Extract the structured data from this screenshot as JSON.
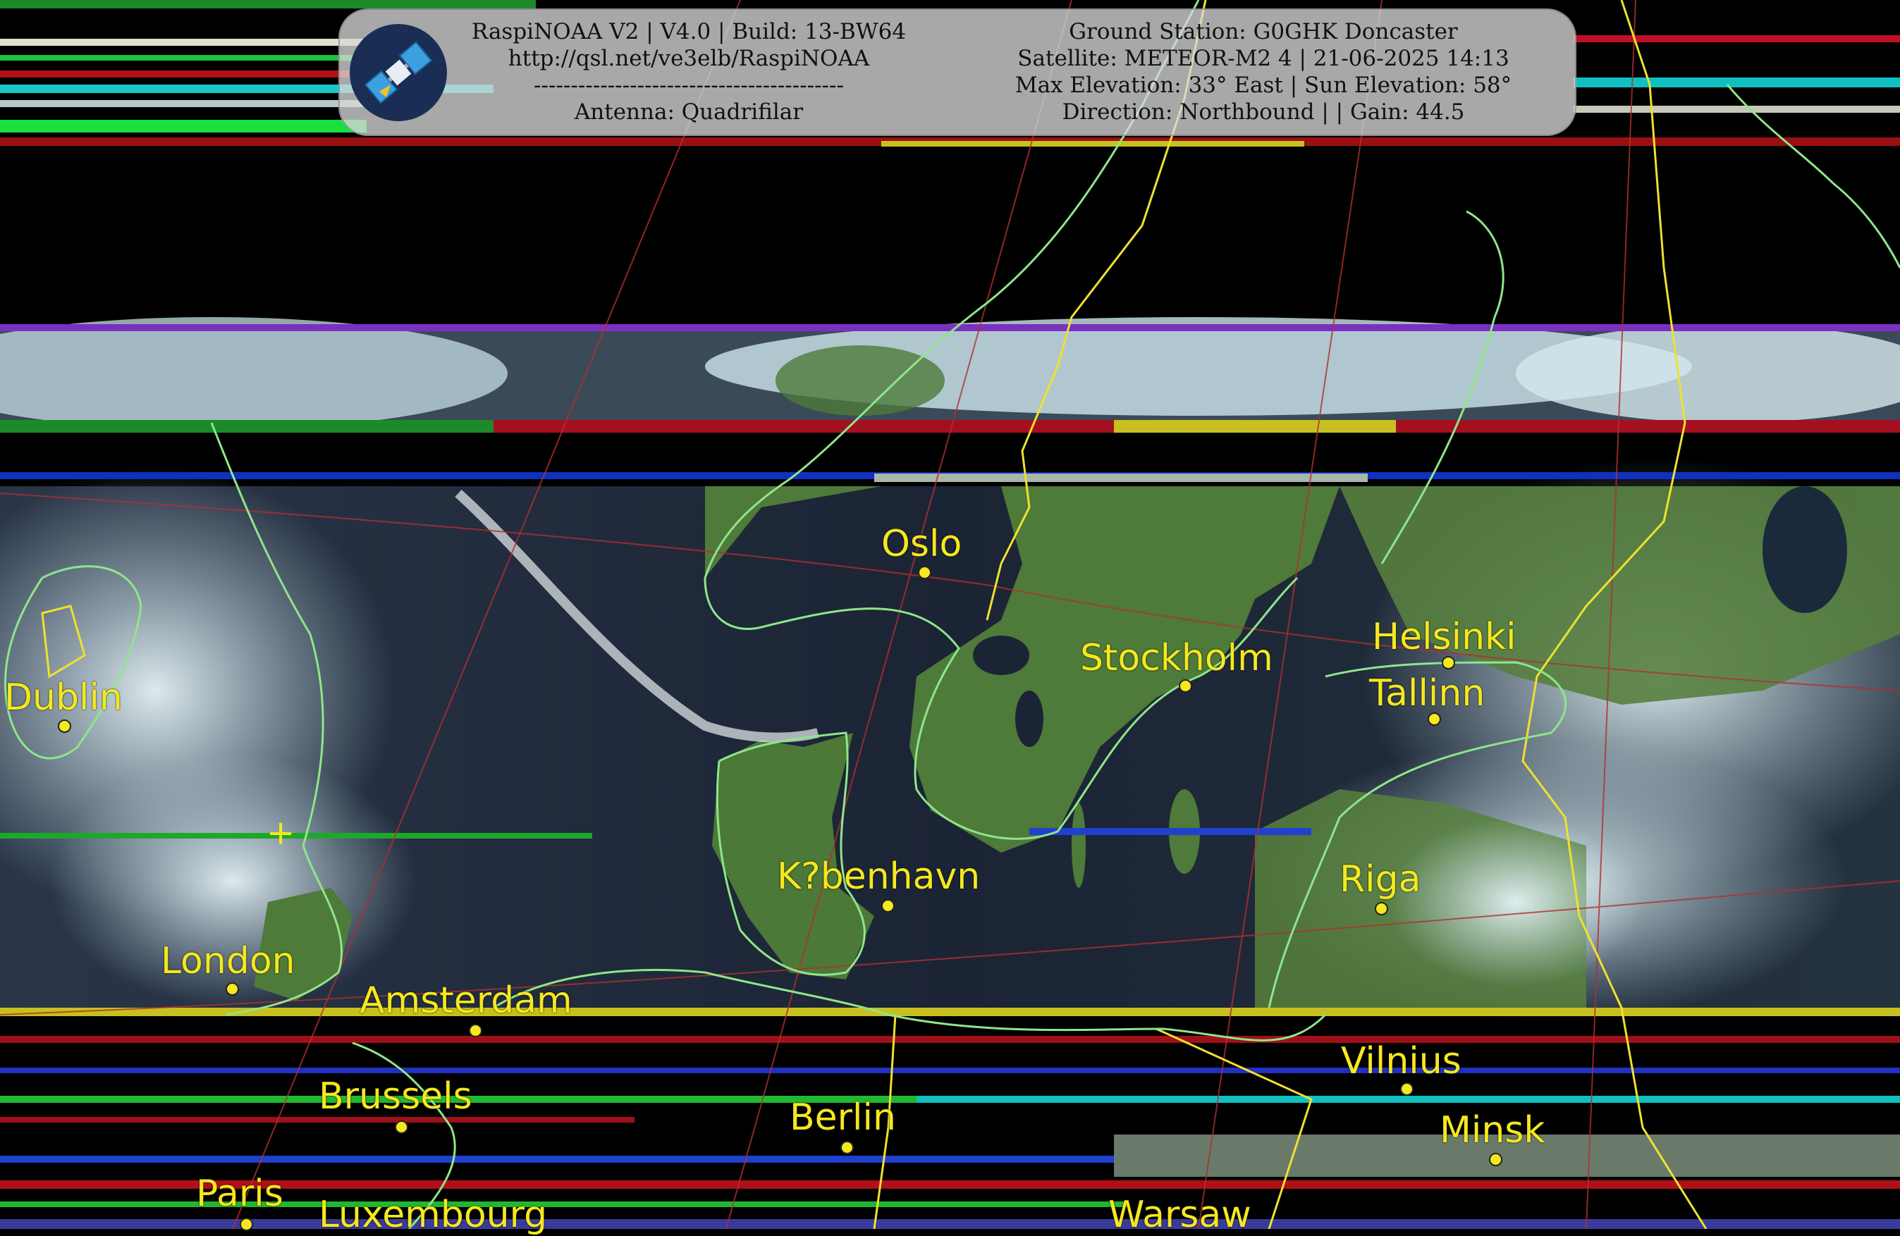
{
  "header": {
    "left_lines": [
      "RaspiNOAA V2 | V4.0 | Build: 13-BW64",
      "http://qsl.net/ve3elb/RaspiNOAA",
      "------------------------------------------",
      "Antenna: Quadrifilar"
    ],
    "right_lines": [
      "Ground Station: G0GHK Doncaster",
      "Satellite: METEOR-M2 4 | 21-06-2025 14:13",
      "Max Elevation: 33° East | Sun Elevation: 58°",
      "Direction: Northbound | | Gain: 44.5"
    ],
    "logo_icon": "satellite-icon"
  },
  "cities": [
    {
      "id": "oslo",
      "label": "Oslo"
    },
    {
      "id": "stockholm",
      "label": "Stockholm"
    },
    {
      "id": "helsinki",
      "label": "Helsinki"
    },
    {
      "id": "tallinn",
      "label": "Tallinn"
    },
    {
      "id": "dublin",
      "label": "Dublin"
    },
    {
      "id": "kobenhavn",
      "label": "K?benhavn"
    },
    {
      "id": "riga",
      "label": "Riga"
    },
    {
      "id": "london",
      "label": "London"
    },
    {
      "id": "amsterdam",
      "label": "Amsterdam"
    },
    {
      "id": "vilnius",
      "label": "Vilnius"
    },
    {
      "id": "brussels",
      "label": "Brussels"
    },
    {
      "id": "berlin",
      "label": "Berlin"
    },
    {
      "id": "minsk",
      "label": "Minsk"
    },
    {
      "id": "paris",
      "label": "Paris"
    },
    {
      "id": "luxembourg",
      "label": "Luxembourg"
    },
    {
      "id": "warsaw",
      "label": "Warsaw"
    }
  ],
  "colors": {
    "label": "#f5e81e",
    "coastline": "#8ee68a",
    "border": "#f0e030",
    "graticule": "#b03030",
    "sea": "#1c2636",
    "land": "#4e7a3a",
    "cloud": "#cfe6ee"
  }
}
